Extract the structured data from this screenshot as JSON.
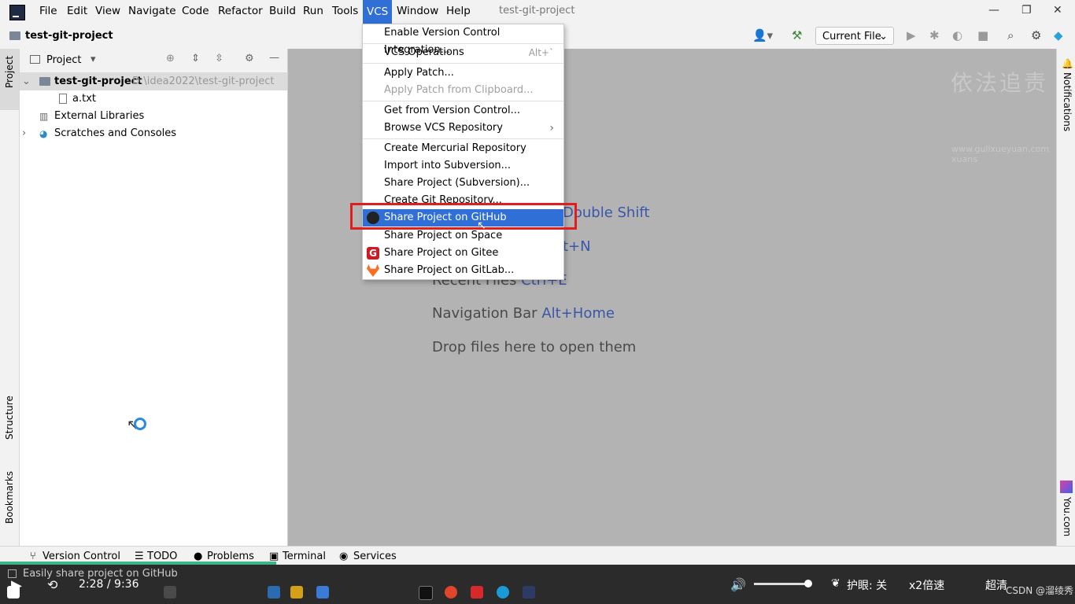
{
  "menubar": {
    "items": [
      "File",
      "Edit",
      "View",
      "Navigate",
      "Code",
      "Refactor",
      "Build",
      "Run",
      "Tools",
      "VCS",
      "Window",
      "Help"
    ],
    "window_title": "test-git-project"
  },
  "navbar": {
    "project_name": "test-git-project",
    "run_config": "Current File"
  },
  "project_panel": {
    "title": "Project",
    "tree": [
      {
        "label": "test-git-project",
        "path": "D:\\idea2022\\test-git-project"
      },
      {
        "label": "a.txt"
      },
      {
        "label": "External Libraries"
      },
      {
        "label": "Scratches and Consoles"
      }
    ]
  },
  "left_strip": {
    "project": "Project",
    "structure": "Structure",
    "bookmarks": "Bookmarks"
  },
  "right_strip": {
    "notifications": "Notifications",
    "you": "You.com"
  },
  "editor": {
    "hints": [
      {
        "text": "",
        "key": "Double Shift"
      },
      {
        "text": "",
        "key": "t+N"
      },
      {
        "text": "Recent Files",
        "key": "Ctrl+E"
      },
      {
        "text": "Navigation Bar",
        "key": "Alt+Home"
      },
      {
        "text": "Drop files here to open them",
        "key": ""
      }
    ],
    "watermark_url": "www.gulixueyuan.com xuans"
  },
  "vcs_menu": {
    "items": [
      {
        "label": "Enable Version Control Integration...",
        "shortcut": ""
      },
      {
        "label": "VCS Operations",
        "shortcut": "Alt+`"
      },
      {
        "label": "Apply Patch...",
        "shortcut": ""
      },
      {
        "label": "Apply Patch from Clipboard...",
        "shortcut": ""
      },
      {
        "label": "Get from Version Control...",
        "shortcut": ""
      },
      {
        "label": "Browse VCS Repository",
        "shortcut": ""
      },
      {
        "label": "Create Mercurial Repository",
        "shortcut": ""
      },
      {
        "label": "Import into Subversion...",
        "shortcut": ""
      },
      {
        "label": "Share Project (Subversion)...",
        "shortcut": ""
      },
      {
        "label": "Create Git Repository...",
        "shortcut": ""
      },
      {
        "label": "Share Project on GitHub",
        "shortcut": ""
      },
      {
        "label": "Share Project on Space",
        "shortcut": ""
      },
      {
        "label": "Share Project on Gitee",
        "shortcut": ""
      },
      {
        "label": "Share Project on GitLab...",
        "shortcut": ""
      }
    ]
  },
  "bottom_tools": {
    "items": [
      "Version Control",
      "TODO",
      "Problems",
      "Terminal",
      "Services"
    ]
  },
  "status": {
    "message": "Easily share project on GitHub",
    "time": "2:28 / 9:36",
    "eye": "护眼: 关",
    "speed": "x2倍速",
    "quality": "超清",
    "csdn": "CSDN @溜绫秀"
  },
  "colors": {
    "accent": "#2f6fd6",
    "highlight_box": "#e01e1e",
    "editor_bg": "#b3b3b3"
  }
}
